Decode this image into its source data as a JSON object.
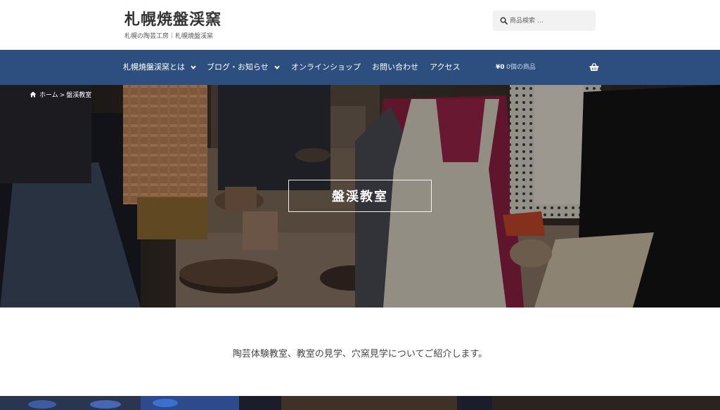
{
  "header": {
    "site_title": "札幌焼盤渓窯",
    "site_description": "札幌の陶芸工房｜札幌焼盤渓窯",
    "search": {
      "placeholder": "商品検索 …",
      "icon": "search-icon"
    }
  },
  "nav": {
    "items": [
      {
        "label": "札幌焼盤渓窯とは",
        "has_dropdown": true
      },
      {
        "label": "ブログ・お知らせ",
        "has_dropdown": true
      },
      {
        "label": "オンラインショップ",
        "has_dropdown": false
      },
      {
        "label": "お問い合わせ",
        "has_dropdown": false
      },
      {
        "label": "アクセス",
        "has_dropdown": false
      }
    ],
    "cart": {
      "amount": "¥0",
      "count_label": "0個の商品",
      "icon": "basket-icon"
    }
  },
  "hero": {
    "breadcrumb": {
      "home_label": "ホーム",
      "separator": ">",
      "current": "盤渓教室"
    },
    "title": "盤渓教室"
  },
  "intro": {
    "text": "陶芸体験教室、教室の見学、穴窯見学についてご紹介します。"
  },
  "colors": {
    "nav_background": "#2d4f7f",
    "search_background": "#f2f2f2",
    "text": "#333333"
  }
}
